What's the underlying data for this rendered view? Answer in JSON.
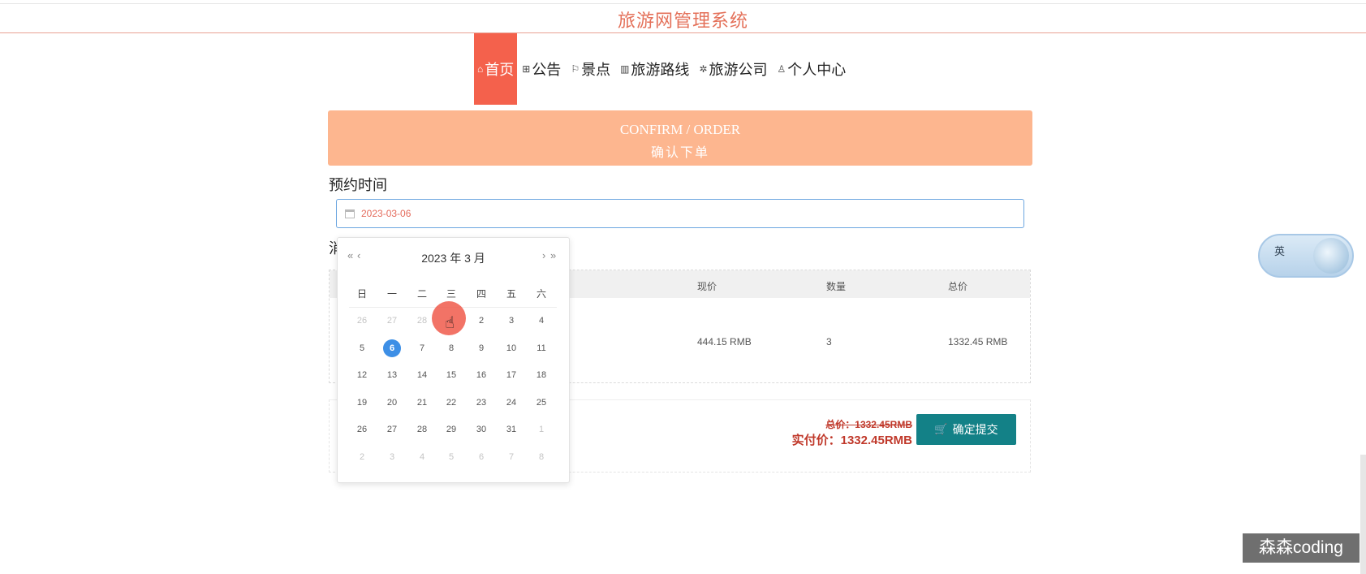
{
  "site_title": "旅游网管理系统",
  "nav": {
    "items": [
      {
        "icon": "⌂",
        "label": "首页"
      },
      {
        "icon": "⊞",
        "label": "公告"
      },
      {
        "icon": "⚐",
        "label": "景点"
      },
      {
        "icon": "▥",
        "label": "旅游路线"
      },
      {
        "icon": "✲",
        "label": "旅游公司"
      },
      {
        "icon": "♙",
        "label": "个人中心"
      }
    ],
    "active": "首页"
  },
  "banner": {
    "en": "CONFIRM / ORDER",
    "cn": "确认下单"
  },
  "booking": {
    "label": "预约时间",
    "date_value": "2023-03-06"
  },
  "table": {
    "headers": [
      "现价",
      "数量",
      "总价"
    ],
    "row": {
      "price": "444.15 RMB",
      "qty": "3",
      "total": "1332.45 RMB"
    }
  },
  "summary": {
    "orig_total_label": "总价：",
    "orig_total_value": "1332.45RMB",
    "real_total_label": "实付价：",
    "real_total_value": "1332.45RMB",
    "submit_label": "确定提交"
  },
  "calendar": {
    "title": "2023 年  3 月",
    "prev_year": "«",
    "prev_month": "‹",
    "next_month": "›",
    "next_year": "»",
    "weekdays": [
      "日",
      "一",
      "二",
      "三",
      "四",
      "五",
      "六"
    ],
    "weeks": [
      [
        "26",
        "27",
        "28",
        "1",
        "2",
        "3",
        "4"
      ],
      [
        "5",
        "6",
        "7",
        "8",
        "9",
        "10",
        "11"
      ],
      [
        "12",
        "13",
        "14",
        "15",
        "16",
        "17",
        "18"
      ],
      [
        "19",
        "20",
        "21",
        "22",
        "23",
        "24",
        "25"
      ],
      [
        "26",
        "27",
        "28",
        "29",
        "30",
        "31",
        "1"
      ],
      [
        "2",
        "3",
        "4",
        "5",
        "6",
        "7",
        "8"
      ]
    ],
    "selected": "6"
  },
  "ime": {
    "label": "英"
  },
  "watermark": "森森coding",
  "colors": {
    "accent": "#f4614c",
    "banner": "#fdb68f",
    "button": "#138187",
    "price": "#c0392b",
    "selected": "#3d8fe6"
  }
}
